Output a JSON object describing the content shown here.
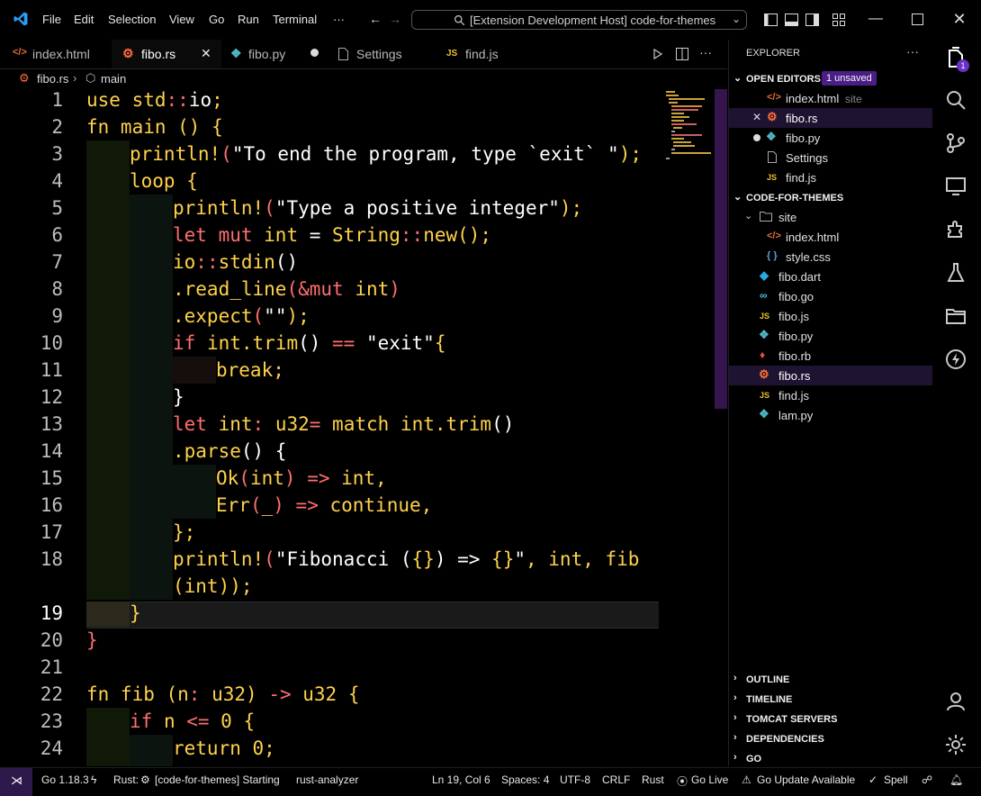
{
  "titlebar": {
    "menu": [
      "File",
      "Edit",
      "Selection",
      "View",
      "Go",
      "Run",
      "Terminal",
      "···"
    ],
    "search_text": "[Extension Development Host] code-for-themes"
  },
  "tabs": [
    {
      "label": "index.html",
      "icon": "html-icon"
    },
    {
      "label": "fibo.rs",
      "icon": "rust-icon"
    },
    {
      "label": "fibo.py",
      "icon": "python-icon"
    },
    {
      "label": "Settings",
      "icon": "file-icon"
    },
    {
      "label": "find.js",
      "icon": "js-icon"
    }
  ],
  "breadcrumb": {
    "file": "fibo.rs",
    "symbol": "main"
  },
  "editor": {
    "line_numbers": [
      "1",
      "2",
      "3",
      "4",
      "5",
      "6",
      "7",
      "8",
      "9",
      "10",
      "11",
      "12",
      "13",
      "14",
      "15",
      "16",
      "17",
      "18",
      "",
      "19",
      "20",
      "21",
      "22",
      "23",
      "24"
    ],
    "current_line": "19"
  },
  "code": {
    "l1_a": "use ",
    "l1_b": "std",
    "l1_c": "::",
    "l1_d": "io",
    "l1_e": ";",
    "l2_a": "fn main () {",
    "l3_a": "println!",
    "l3_b": "(",
    "l3_c": "\"To end the program, type `exit` \"",
    "l3_d": ");",
    "l4_a": "loop {",
    "l5_a": "println!",
    "l5_b": "(",
    "l5_c": "\"Type a positive integer\"",
    "l5_d": ");",
    "l6_a": "let mut ",
    "l6_b": "int",
    "l6_c": " = ",
    "l6_d": "String",
    "l6_e": "::",
    "l6_f": "new",
    "l6_g": "();",
    "l7_a": "io",
    "l7_b": "::",
    "l7_c": "stdin",
    "l7_d": "()",
    "l8_a": ".read_line",
    "l8_b": "(",
    "l8_c": "&mut ",
    "l8_d": "int",
    "l8_e": ")",
    "l9_a": ".expect",
    "l9_b": "(",
    "l9_c": "\"\"",
    "l9_d": ");",
    "l10_a": "if ",
    "l10_b": "int",
    "l10_c": ".trim",
    "l10_d": "() ",
    "l10_e": "==",
    "l10_f": " \"exit\"",
    "l10_g": "{",
    "l11_a": "break;",
    "l12_a": "}",
    "l13_a": "let ",
    "l13_b": "int",
    "l13_c": ": ",
    "l13_d": "u32",
    "l13_e": "=",
    "l13_f": " match ",
    "l13_g": "int",
    "l13_h": ".trim",
    "l13_i": "()",
    "l14_a": ".parse",
    "l14_b": "() {",
    "l15_a": "Ok",
    "l15_b": "(",
    "l15_c": "int",
    "l15_d": ") ",
    "l15_e": "=>",
    "l15_f": " int,",
    "l16_a": "Err",
    "l16_b": "(",
    "l16_c": "_",
    "l16_d": ") ",
    "l16_e": "=>",
    "l16_f": " continue,",
    "l17_a": "};",
    "l18_a": "println!",
    "l18_b": "(",
    "l18_c": "\"Fibonacci (",
    "l18_d": "{}",
    "l18_e": ") => ",
    "l18_f": "{}",
    "l18_g": "\"",
    "l18_h": ", int, fib",
    "l18w_a": "(int)",
    "l18w_b": ");",
    "l19_a": "}",
    "l20_a": "}",
    "l22_a": "fn fib (n",
    "l22_b": ": ",
    "l22_c": "u32",
    "l22_d": ") ",
    "l22_e": "->",
    "l22_f": " u32 {",
    "l23_a": "if ",
    "l23_b": "n ",
    "l23_c": "<=",
    "l23_d": " 0",
    "l23_e": " {",
    "l24_a": "return ",
    "l24_b": "0",
    "l24_c": ";"
  },
  "sidebar": {
    "title": "EXPLORER",
    "open_editors_label": "OPEN EDITORS",
    "unsaved_badge": "1 unsaved",
    "open_editors": [
      {
        "label": "index.html",
        "detail": "site"
      },
      {
        "label": "fibo.rs",
        "detail": ""
      },
      {
        "label": "fibo.py",
        "detail": ""
      },
      {
        "label": "Settings",
        "detail": ""
      },
      {
        "label": "find.js",
        "detail": ""
      }
    ],
    "workspace_label": "CODE-FOR-THEMES",
    "tree": [
      {
        "label": "site"
      },
      {
        "label": "index.html"
      },
      {
        "label": "style.css"
      },
      {
        "label": "fibo.dart"
      },
      {
        "label": "fibo.go"
      },
      {
        "label": "fibo.js"
      },
      {
        "label": "fibo.py"
      },
      {
        "label": "fibo.rb"
      },
      {
        "label": "fibo.rs"
      },
      {
        "label": "find.js"
      },
      {
        "label": "lam.py"
      }
    ],
    "sections": [
      "OUTLINE",
      "TIMELINE",
      "TOMCAT SERVERS",
      "DEPENDENCIES",
      "GO"
    ]
  },
  "activitybar": {
    "explorer_badge": "1"
  },
  "statusbar": {
    "go_version": "Go 1.18.3",
    "rust_status": "Rust: ",
    "rust_task": "[code-for-themes] Starting",
    "analyzer": "rust-analyzer",
    "position": "Ln 19, Col 6",
    "spaces": "Spaces: 4",
    "encoding": "UTF-8",
    "eol": "CRLF",
    "language": "Rust",
    "go_live": "Go Live",
    "go_update": "Go Update Available",
    "spell": "Spell"
  },
  "colors": {
    "keyword": "#ffd24a",
    "string": "#ffb24a",
    "type": "#ff6e6e",
    "accent": "#7c3aed",
    "selection": "#1e1331"
  }
}
